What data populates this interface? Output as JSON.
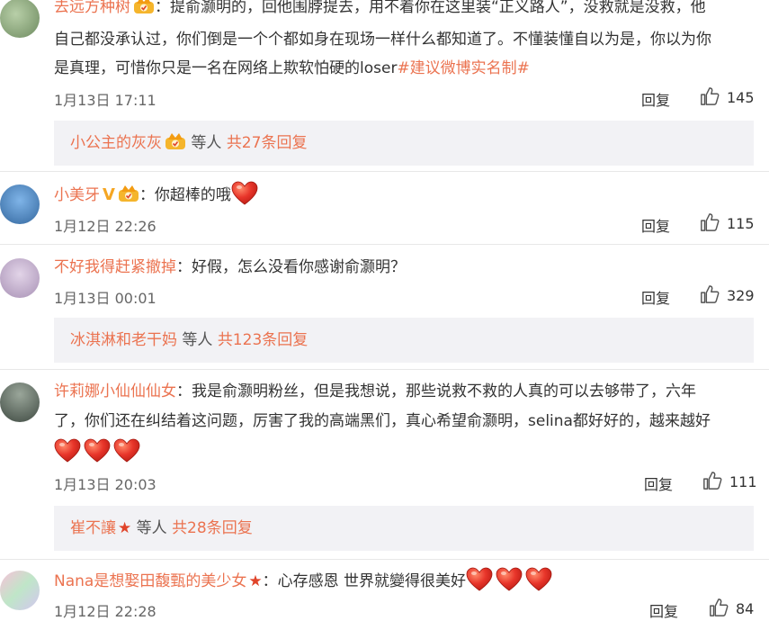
{
  "comments": [
    {
      "user": "去远方种树",
      "text_lines": [
        "：提俞灏明的，回他围脖提去，用不着你在这里装“正义路人”，没救就是没救，他",
        "自己都没承认过，你们倒是一个个都如身在现场一样什么都知道了。不懂装懂自以为是，你以为你",
        "是真理，可惜你只是一名在网络上欺软怕硬的loser"
      ],
      "hashtag": "#建议微博实名制#",
      "time": "1月13日 17:11",
      "reply": "回复",
      "likes": "145"
    },
    {
      "user": "小美牙",
      "text": "：你超棒的哦",
      "time": "1月12日 22:26",
      "reply": "回复",
      "likes": "115"
    },
    {
      "user": "不好我得赶紧撤掉",
      "text": "：好假，怎么没看你感谢俞灏明？",
      "time": "1月13日 00:01",
      "reply": "回复",
      "likes": "329"
    },
    {
      "user": "许莉娜小仙仙仙女",
      "text_lines": [
        "：我是俞灏明粉丝，但是我想说，那些说救不救的人真的可以去够带了，六年",
        "了，你们还在纠结着这问题，厉害了我的高端黑们，真心希望俞灏明，selina都好好的，越来越好"
      ],
      "time": "1月13日 20:03",
      "reply": "回复",
      "likes": "111"
    },
    {
      "user": "Nana是想娶田馥甄的美少女",
      "text": "：心存感恩 世界就變得很美好",
      "time": "1月12日 22:28",
      "reply": "回复",
      "likes": "84"
    }
  ],
  "sub_replies": [
    {
      "user": "小公主的灰灰",
      "middle": " 等人 ",
      "total": "共27条回复"
    },
    {
      "user": "冰淇淋和老干妈",
      "middle": " 等人 ",
      "total": "共123条回复"
    },
    {
      "user": "崔不讓",
      "middle": " 等人 ",
      "total": "共28条回复"
    }
  ],
  "icons": {
    "verified": "V",
    "vip": "vip-crown-icon",
    "star": "★",
    "heart": "heart-icon",
    "like": "thumbs-up-icon"
  },
  "colors": {
    "accent": "#eb7350",
    "subBg": "#f2f2f5",
    "heart": "#e8352a"
  }
}
